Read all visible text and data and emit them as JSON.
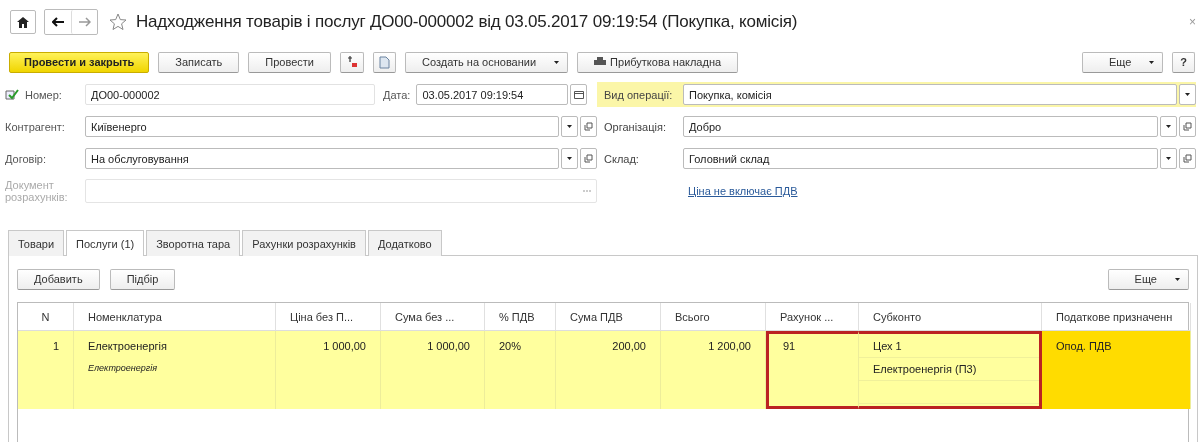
{
  "window": {
    "title": "Надходження товарів і послуг ДО00-000002 від 03.05.2017 09:19:54 (Покупка, комісія)",
    "close": "×"
  },
  "toolbar": [
    {
      "kind": "primary",
      "label": "Провести и закрыть"
    },
    {
      "kind": "normal",
      "label": "Записать"
    },
    {
      "kind": "normal",
      "label": "Провести"
    },
    {
      "kind": "dt-icon"
    },
    {
      "kind": "doc-icon"
    },
    {
      "kind": "menu",
      "label": "Создать на основании"
    },
    {
      "kind": "print",
      "label": "Прибуткова накладна"
    }
  ],
  "toolbar_right": [
    {
      "kind": "menu",
      "label": "Еще"
    },
    {
      "kind": "normal",
      "label": "?"
    }
  ],
  "number": {
    "label": "Номер:",
    "value": "ДО00-000002"
  },
  "date": {
    "label": "Дата:",
    "value": "03.05.2017 09:19:54"
  },
  "operation": {
    "label": "Вид операції:",
    "value": "Покупка, комісія",
    "highlighted": true
  },
  "left_fields": [
    {
      "label": "Контрагент:",
      "value": "Київенерго",
      "disabled": false
    },
    {
      "label": "Договір:",
      "value": "На обслуговування",
      "disabled": false
    },
    {
      "label": "Документ розрахунків:",
      "disabled": true
    }
  ],
  "right_fields": [
    {
      "label": "Організація:",
      "value": "Добро"
    },
    {
      "label": "Склад:",
      "value": "Головний склад"
    }
  ],
  "price_link": "Ціна не включає ПДВ",
  "tabs": [
    {
      "label": "Товари",
      "selected": false
    },
    {
      "label": "Послуги (1)",
      "selected": true
    },
    {
      "label": "Зворотна тара",
      "selected": false
    },
    {
      "label": "Рахунки розрахунків",
      "selected": false
    },
    {
      "label": "Додатково",
      "selected": false
    }
  ],
  "table_buttons": [
    {
      "label": "Добавить"
    },
    {
      "label": "Підбір"
    }
  ],
  "table_more": {
    "label": "Еще"
  },
  "table": {
    "columns": [
      {
        "label": "N",
        "kind": "number"
      },
      {
        "label": "Номенклатура",
        "kind": "text"
      },
      {
        "label": "Ціна без П...",
        "kind": "number"
      },
      {
        "label": "Сума без ...",
        "kind": "number"
      },
      {
        "label": "% ПДВ",
        "kind": "text"
      },
      {
        "label": "Сума ПДВ",
        "kind": "number"
      },
      {
        "label": "Всього",
        "kind": "number"
      },
      {
        "label": "Рахунок ...",
        "kind": "text"
      },
      {
        "label": "Субконто",
        "kind": "list"
      },
      {
        "label": "Податкове призначенн",
        "kind": "text"
      }
    ],
    "rows": [
      {
        "selected": true,
        "cells": [
          {
            "lines": [
              {
                "text": "1",
                "kind": "main"
              }
            ],
            "outlined": false,
            "current": false
          },
          {
            "lines": [
              {
                "text": "Електроенергія",
                "kind": "main"
              },
              {
                "text": "Електроенергія",
                "kind": "note"
              }
            ],
            "outlined": false,
            "current": false
          },
          {
            "lines": [
              {
                "text": "1 000,00",
                "kind": "main"
              }
            ],
            "outlined": false,
            "current": false
          },
          {
            "lines": [
              {
                "text": "1 000,00",
                "kind": "main"
              }
            ],
            "outlined": false,
            "current": false
          },
          {
            "lines": [
              {
                "text": "20%",
                "kind": "main"
              }
            ],
            "outlined": false,
            "current": false
          },
          {
            "lines": [
              {
                "text": "200,00",
                "kind": "main"
              }
            ],
            "outlined": false,
            "current": false
          },
          {
            "lines": [
              {
                "text": "1 200,00",
                "kind": "main"
              }
            ],
            "outlined": false,
            "current": false
          },
          {
            "lines": [
              {
                "text": "91",
                "kind": "main"
              }
            ],
            "outlined": true,
            "current": false
          },
          {
            "lines": [
              {
                "text": "Цех 1",
                "kind": "main"
              },
              {
                "text": "Електроенергія (П3)",
                "kind": "main"
              }
            ],
            "outlined": true,
            "current": false
          },
          {
            "lines": [
              {
                "text": "Опод. ПДВ",
                "kind": "main"
              }
            ],
            "outlined": false,
            "current": true
          }
        ]
      }
    ]
  }
}
